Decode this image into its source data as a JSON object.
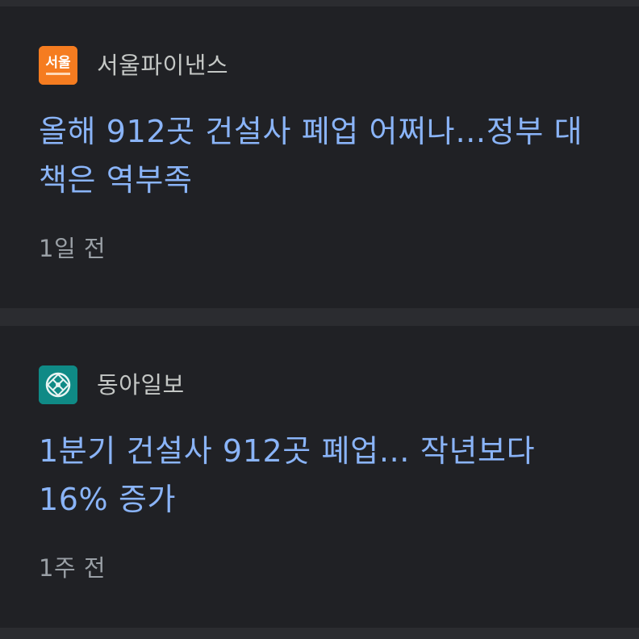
{
  "articles": [
    {
      "source": {
        "name": "서울파이낸스",
        "logo_text": "서울",
        "logo_icon": "seoul-finance-logo",
        "logo_color": "#f57c20"
      },
      "headline": "올해 912곳 건설사 폐업 어쩌나…정부 대책은 역부족",
      "time": "1일 전"
    },
    {
      "source": {
        "name": "동아일보",
        "logo_icon": "donga-ilbo-logo",
        "logo_color": "#0f8a86"
      },
      "headline": "1분기 건설사 912곳 폐업… 작년보다 16% 증가",
      "time": "1주 전"
    }
  ],
  "colors": {
    "background": "#202125",
    "separator": "#2b2c30",
    "headline": "#8ab4f8",
    "source": "#c4c7c5",
    "time": "#9aa0a6"
  }
}
